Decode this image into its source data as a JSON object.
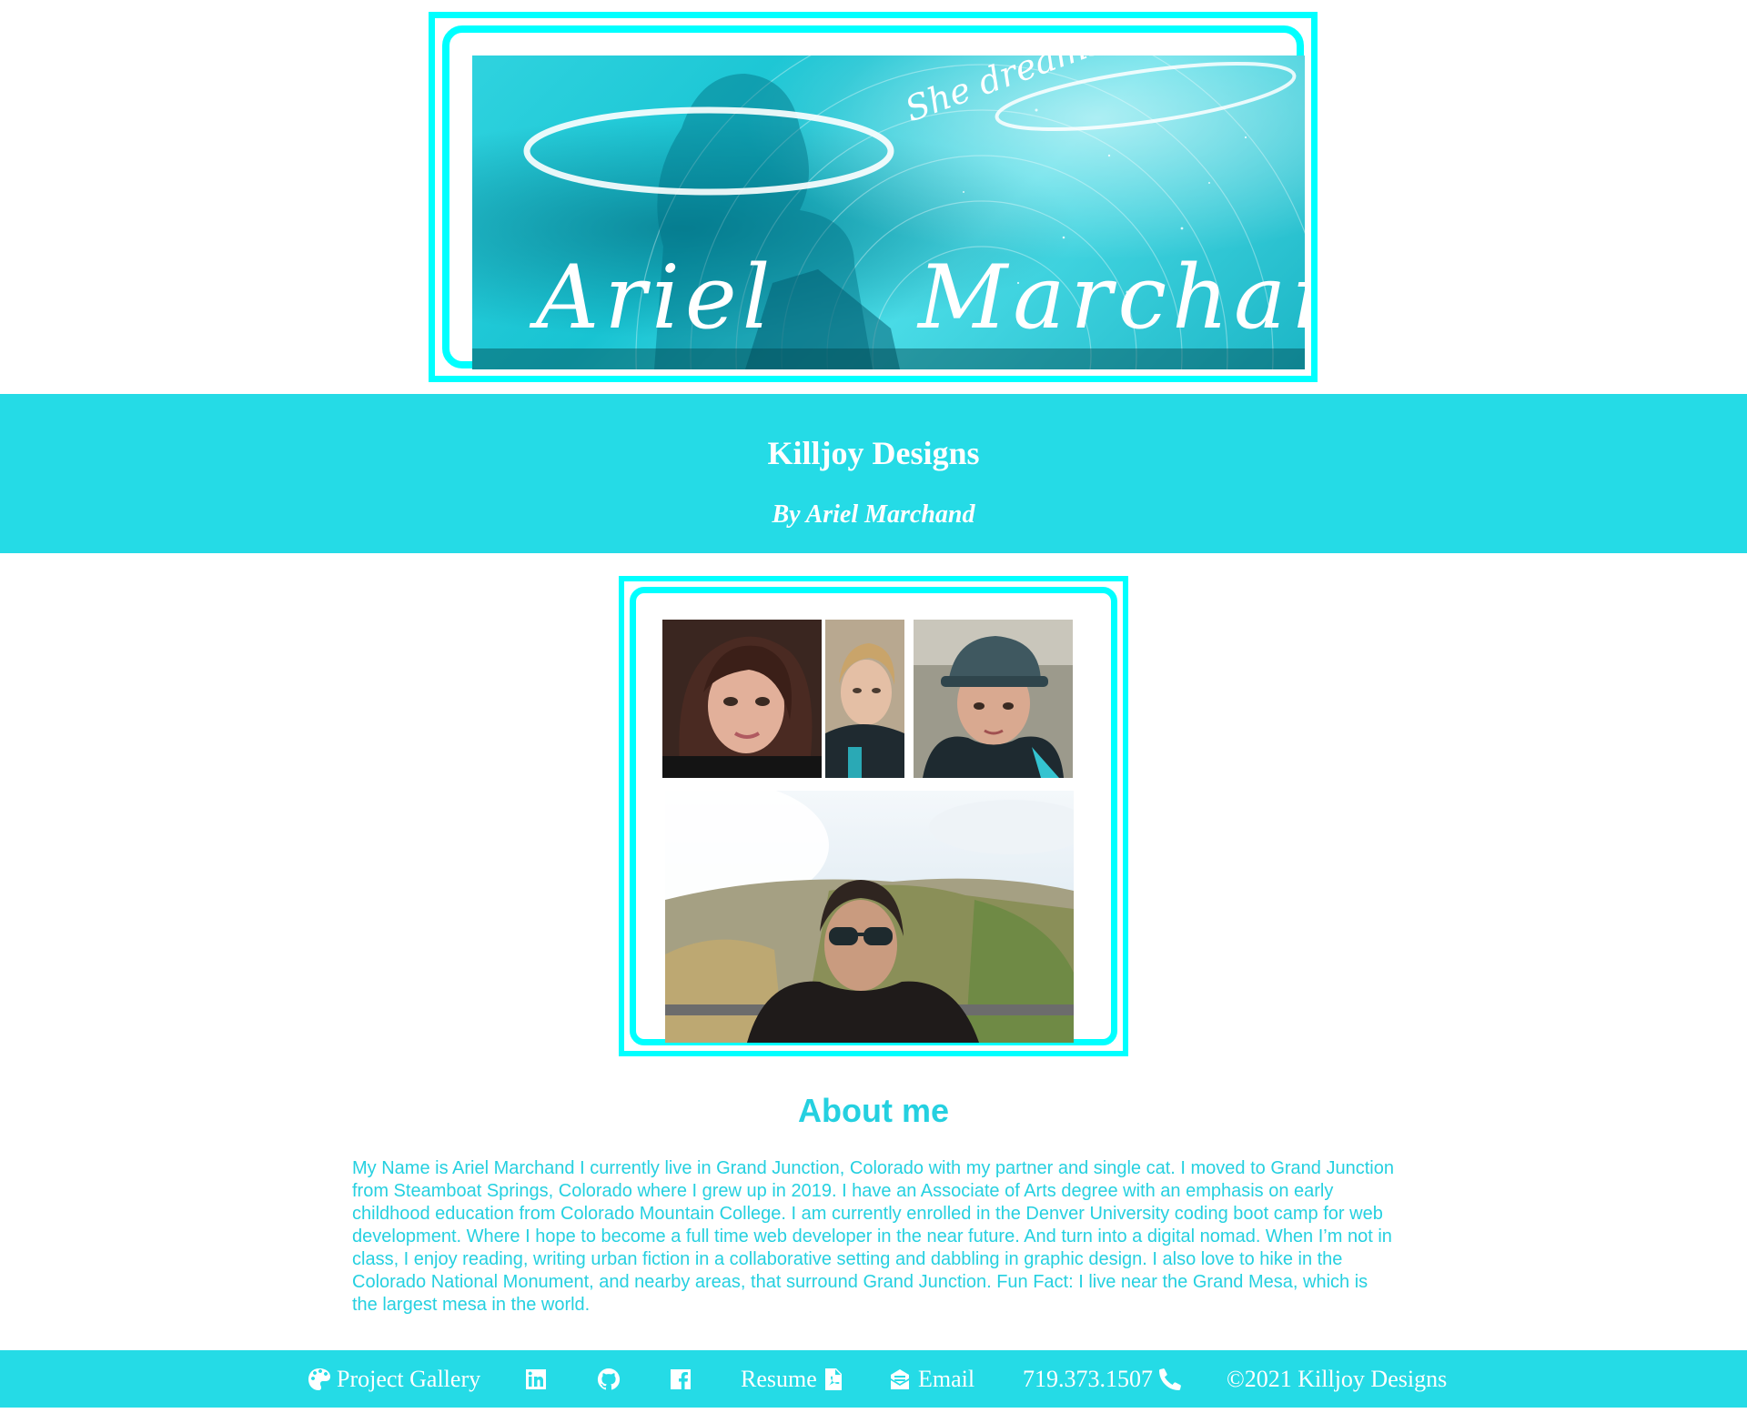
{
  "banner": {
    "tagline": "She dreams in digital",
    "name": "Ariel Marchand"
  },
  "header": {
    "title": "Killjoy Designs",
    "subtitle": "By Ariel Marchand"
  },
  "collage": {
    "photos": [
      "portrait-photo",
      "selfie-photo",
      "hiking-hat-photo",
      "mesa-overlook-selfie"
    ]
  },
  "about": {
    "heading": "About me",
    "body": "My Name is Ariel Marchand I currently live in Grand Junction, Colorado with my partner and single cat. I moved to Grand Junction from Steamboat Springs, Colorado where I grew up in 2019. I have an Associate of Arts degree with an emphasis on early childhood education from Colorado Mountain College. I am currently enrolled in the Denver University coding boot camp for web development. Where I hope to become a full time web developer in the near future. And turn into a digital nomad. When I’m not in class, I enjoy reading, writing urban fiction in a collaborative setting and dabbling in graphic design. I also love to hike in the Colorado National Monument, and nearby areas, that surround Grand Junction. Fun Fact: I live near the Grand Mesa, which is the largest mesa in the world."
  },
  "footer": {
    "gallery_label": "Project Gallery",
    "resume_label": "Resume",
    "email_label": "Email",
    "phone_label": "719.373.1507",
    "copyright": "©2021 Killjoy Designs",
    "icons": [
      "palette-icon",
      "linkedin-icon",
      "github-icon",
      "facebook-icon",
      "pdf-file-icon",
      "envelope-icon",
      "phone-icon"
    ]
  },
  "colors": {
    "accent": "#25dbe6",
    "frame": "#00ffff",
    "text_accent": "#25d0e0"
  }
}
